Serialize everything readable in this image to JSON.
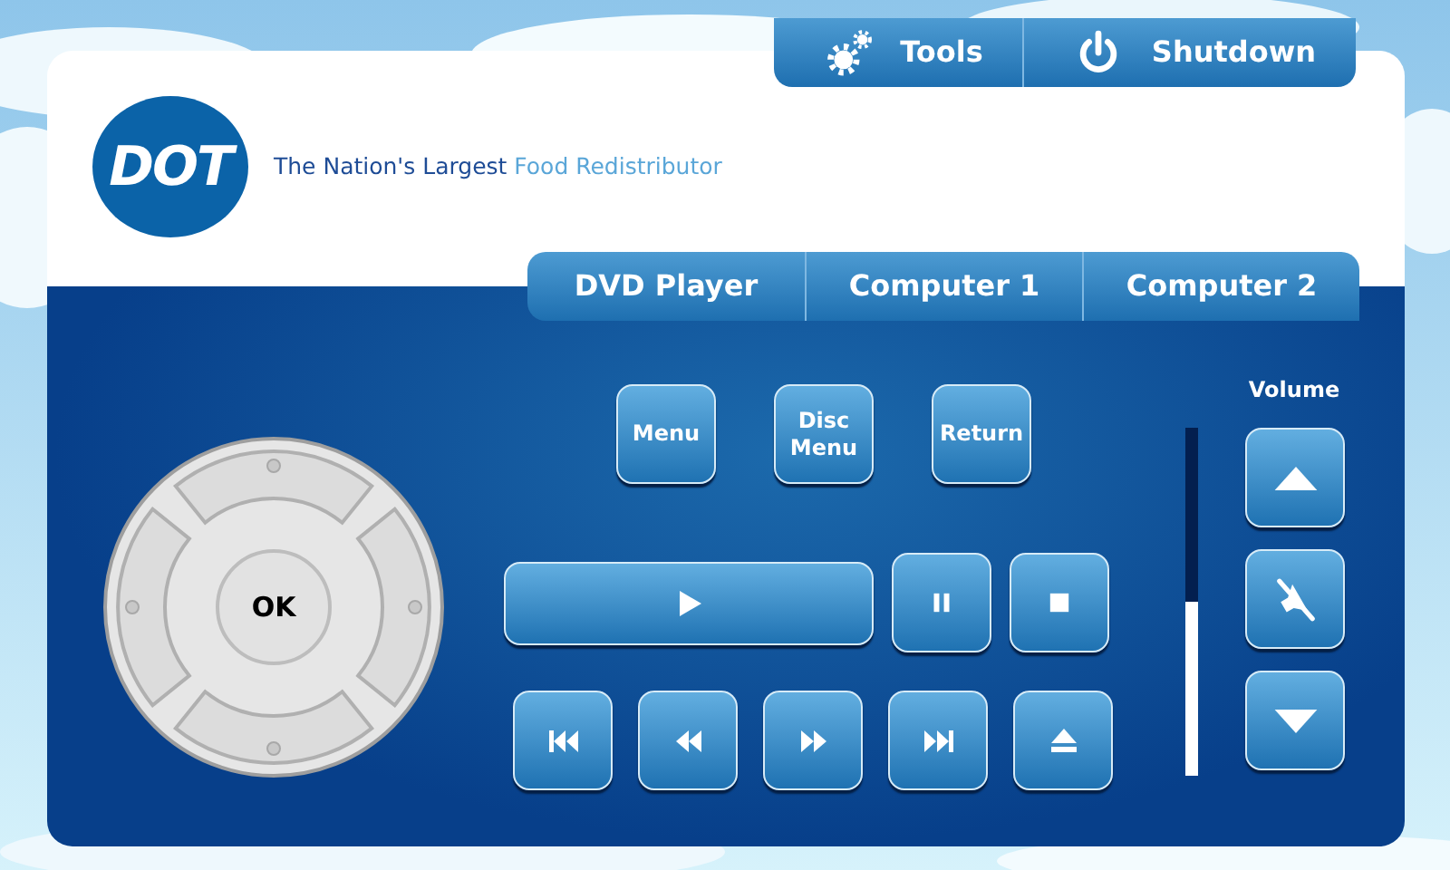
{
  "top_buttons": [
    {
      "label": "Tools",
      "kind": "gears"
    },
    {
      "label": "Shutdown",
      "kind": "power"
    }
  ],
  "logo": {
    "text": "DOT"
  },
  "tagline": {
    "text": "The Nation's Largest",
    "highlight": "Food Redistributor"
  },
  "tabs": [
    {
      "label": "DVD Player"
    },
    {
      "label": "Computer 1"
    },
    {
      "label": "Computer 2"
    }
  ],
  "dpad": {
    "center_label": "OK"
  },
  "menu_buttons": [
    {
      "label": "Menu"
    },
    {
      "label": "Disc Menu"
    },
    {
      "label": "Return"
    }
  ],
  "transport": [
    {
      "kind": "play"
    },
    {
      "kind": "pause"
    },
    {
      "kind": "stop"
    }
  ],
  "transport_2": [
    {
      "kind": "previous"
    },
    {
      "kind": "rewind"
    },
    {
      "kind": "forward"
    },
    {
      "kind": "next"
    },
    {
      "kind": "eject"
    }
  ],
  "volume": {
    "label": "Volume",
    "level": 0.5,
    "buttons": [
      {
        "kind": "up"
      },
      {
        "kind": "mute"
      },
      {
        "kind": "down"
      }
    ]
  }
}
